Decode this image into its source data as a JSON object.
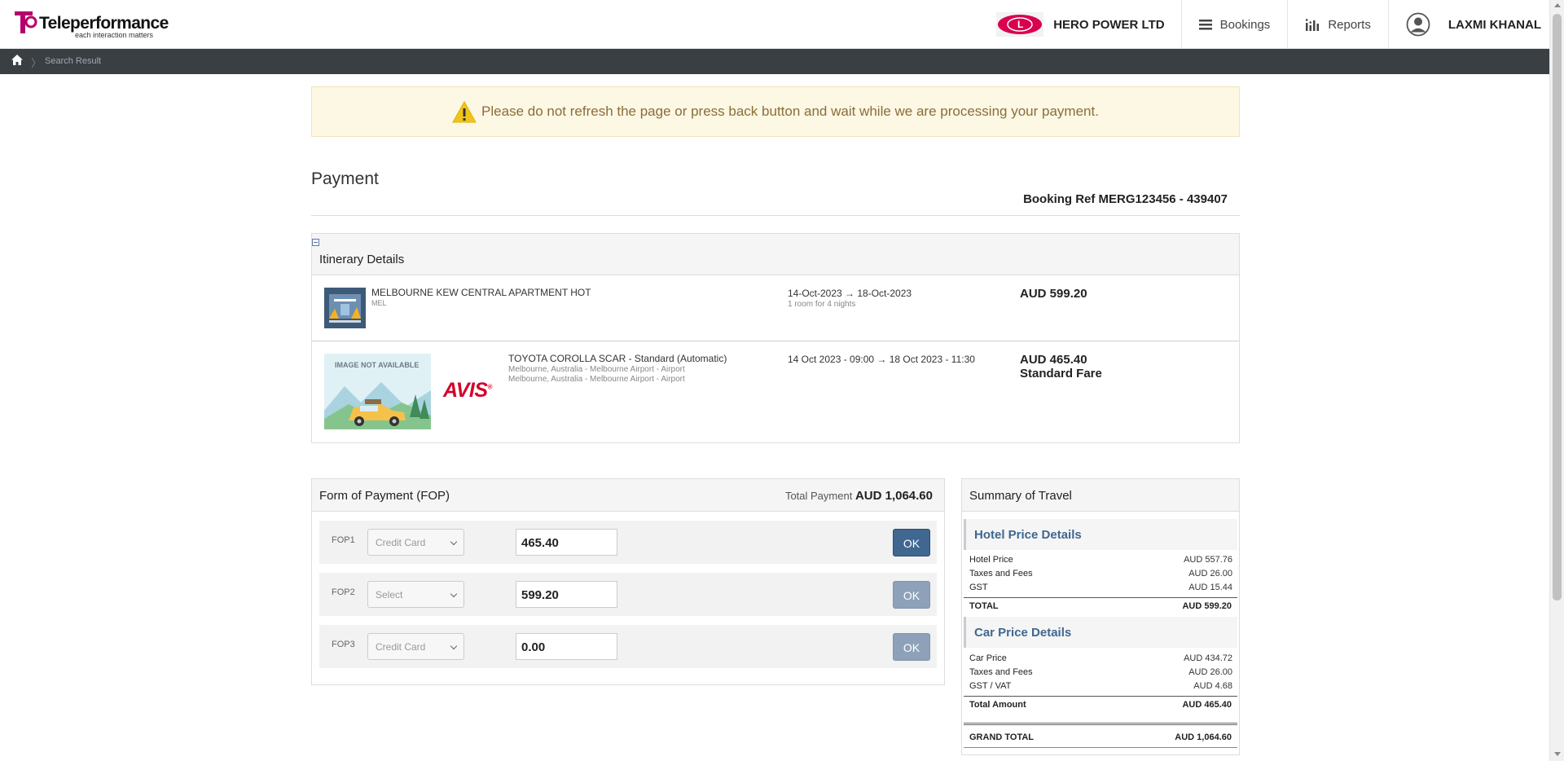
{
  "header": {
    "logo_text": "Teleperformance",
    "logo_tagline": "each interaction matters",
    "company_name": "HERO POWER LTD",
    "company_logo_text": "L",
    "nav_bookings": "Bookings",
    "nav_reports": "Reports",
    "user_name": "LAXMI KHANAL"
  },
  "breadcrumb": {
    "current": "Search Result"
  },
  "alert": {
    "message": "Please do not refresh the page or press back button and wait while we are processing your payment."
  },
  "page": {
    "title": "Payment",
    "booking_ref": "Booking Ref MERG123456 - 439407"
  },
  "itinerary": {
    "title": "Itinerary Details",
    "hotel": {
      "name": "MELBOURNE KEW CENTRAL APARTMENT HOT",
      "city": "MEL",
      "dates": "14-Oct-2023 → 18-Oct-2023",
      "rooms": "1 room for 4 nights",
      "price": "AUD 599.20"
    },
    "car": {
      "image_text": "IMAGE NOT AVAILABLE",
      "vendor": "AVIS",
      "name": "TOYOTA COROLLA SCAR - Standard (Automatic)",
      "pickup": "Melbourne, Australia - Melbourne Airport - Airport",
      "dropoff": "Melbourne, Australia - Melbourne Airport - Airport",
      "dates": "14 Oct 2023 - 09:00 → 18 Oct 2023 - 11:30",
      "price": "AUD 465.40",
      "fare": "Standard Fare"
    }
  },
  "fop": {
    "title": "Form of Payment (FOP)",
    "total_label": "Total Payment",
    "total_value": "AUD 1,064.60",
    "rows": [
      {
        "label": "FOP1",
        "method": "Credit Card",
        "amount": "465.40",
        "button": "OK"
      },
      {
        "label": "FOP2",
        "method": "Select",
        "amount": "599.20",
        "button": "OK"
      },
      {
        "label": "FOP3",
        "method": "Credit Card",
        "amount": "0.00",
        "button": "OK"
      }
    ]
  },
  "summary": {
    "title": "Summary of Travel",
    "hotel": {
      "title": "Hotel Price Details",
      "lines": [
        {
          "label": "Hotel Price",
          "value": "AUD 557.76"
        },
        {
          "label": "Taxes and Fees",
          "value": "AUD 26.00"
        },
        {
          "label": "GST",
          "value": "AUD 15.44"
        }
      ],
      "total_label": "TOTAL",
      "total_value": "AUD 599.20"
    },
    "car": {
      "title": "Car Price Details",
      "lines": [
        {
          "label": "Car Price",
          "value": "AUD 434.72"
        },
        {
          "label": "Taxes and Fees",
          "value": "AUD 26.00"
        },
        {
          "label": "GST / VAT",
          "value": "AUD 4.68"
        }
      ],
      "total_label": "Total Amount",
      "total_value": "AUD 465.40"
    },
    "grand_label": "GRAND TOTAL",
    "grand_value": "AUD 1,064.60"
  },
  "colors": {
    "accent": "#3f6790",
    "alert_bg": "#fcf8e3",
    "alert_text": "#8a6d3b",
    "crumbbar": "#3a3f44",
    "logo_magenta": "#b5006e",
    "company_red": "#d8004f",
    "avis_red": "#d4002a"
  }
}
